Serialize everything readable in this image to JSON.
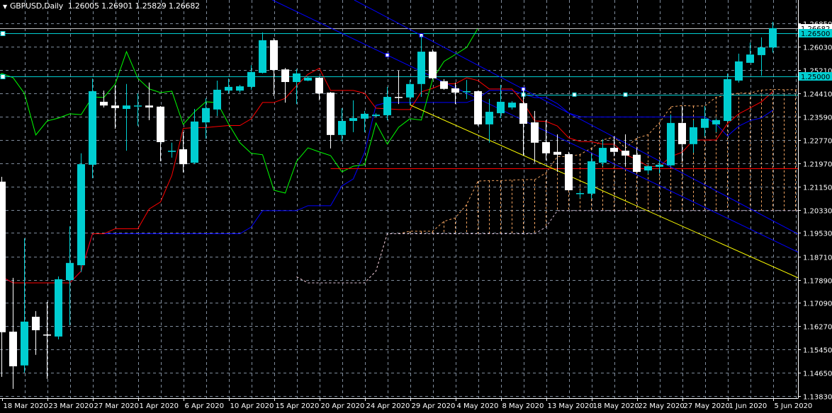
{
  "header": {
    "collapse_icon": "triangle-down-icon",
    "symbol_timeframe": "GBPUSD,Daily",
    "open": "1.26005",
    "high": "1.26901",
    "low": "1.25829",
    "close": "1.26682"
  },
  "colors": {
    "background": "#000000",
    "grid": "#7f8c9c",
    "bull": "#00CED1",
    "bear": "#FFFFFF",
    "tenkan": "#FF0000",
    "kijun": "#0000FF",
    "chikou": "#00FF00",
    "senkou_a": "#F4A460",
    "senkou_b": "#D8BFD8",
    "trend_blue": "#0000FF",
    "trend_yellow": "#FFFF00",
    "level_cyan": "#00CED1",
    "level_red": "#FF0000",
    "bid": "#C0C0C0"
  },
  "chart_data": {
    "type": "candlestick",
    "title": "GBPUSD,Daily",
    "ylim": [
      1.13757,
      1.27665
    ],
    "grid": true,
    "price_ticks": [
      "1.26850",
      "1.26030",
      "1.25210",
      "1.24410",
      "1.23590",
      "1.22770",
      "1.21970",
      "1.21150",
      "1.20330",
      "1.19530",
      "1.18710",
      "1.17890",
      "1.17090",
      "1.16270",
      "1.15450",
      "1.14650",
      "1.13830"
    ],
    "date_labels": [
      {
        "bar": 0,
        "text": "18 Mar 2020"
      },
      {
        "bar": 4,
        "text": "23 Mar 2020"
      },
      {
        "bar": 8,
        "text": "27 Mar 2020"
      },
      {
        "bar": 12,
        "text": "1 Apr 2020"
      },
      {
        "bar": 16,
        "text": "6 Apr 2020"
      },
      {
        "bar": 20,
        "text": "10 Apr 2020"
      },
      {
        "bar": 24,
        "text": "15 Apr 2020"
      },
      {
        "bar": 28,
        "text": "20 Apr 2020"
      },
      {
        "bar": 32,
        "text": "24 Apr 2020"
      },
      {
        "bar": 36,
        "text": "29 Apr 2020"
      },
      {
        "bar": 40,
        "text": "4 May 2020"
      },
      {
        "bar": 44,
        "text": "8 May 2020"
      },
      {
        "bar": 48,
        "text": "13 May 2020"
      },
      {
        "bar": 52,
        "text": "18 May 2020"
      },
      {
        "bar": 56,
        "text": "22 May 2020"
      },
      {
        "bar": 60,
        "text": "27 May 2020"
      },
      {
        "bar": 64,
        "text": "1 Jun 2020"
      },
      {
        "bar": 68,
        "text": "5 Jun 2020"
      }
    ],
    "candles_ohlc": [
      [
        1.2132,
        1.2149,
        1.145,
        1.1606
      ],
      [
        1.1608,
        1.1796,
        1.1408,
        1.1487
      ],
      [
        1.149,
        1.1934,
        1.1465,
        1.1643
      ],
      [
        1.166,
        1.168,
        1.1527,
        1.1613
      ],
      [
        1.1598,
        1.1712,
        1.1443,
        1.1596
      ],
      [
        1.1591,
        1.1801,
        1.1581,
        1.1791
      ],
      [
        1.1788,
        1.1976,
        1.163,
        1.1848
      ],
      [
        1.184,
        1.2231,
        1.1816,
        1.2193
      ],
      [
        1.2191,
        1.2492,
        1.2144,
        1.2448
      ],
      [
        1.2411,
        1.245,
        1.2391,
        1.2398
      ],
      [
        1.2398,
        1.2468,
        1.2317,
        1.2389
      ],
      [
        1.2386,
        1.2473,
        1.224,
        1.2398
      ],
      [
        1.2397,
        1.244,
        1.2327,
        1.2398
      ],
      [
        1.2398,
        1.2478,
        1.2347,
        1.2391
      ],
      [
        1.2394,
        1.2396,
        1.2203,
        1.227
      ],
      [
        1.2236,
        1.2268,
        1.2216,
        1.224
      ],
      [
        1.2245,
        1.2305,
        1.2164,
        1.2193
      ],
      [
        1.2198,
        1.2386,
        1.2193,
        1.2342
      ],
      [
        1.2339,
        1.2423,
        1.2282,
        1.2389
      ],
      [
        1.2384,
        1.2485,
        1.2361,
        1.2453
      ],
      [
        1.245,
        1.2492,
        1.244,
        1.2463
      ],
      [
        1.245,
        1.247,
        1.2443,
        1.2465
      ],
      [
        1.2463,
        1.2539,
        1.2453,
        1.2515
      ],
      [
        1.2512,
        1.2653,
        1.251,
        1.2626
      ],
      [
        1.2626,
        1.2633,
        1.2431,
        1.2522
      ],
      [
        1.2524,
        1.2529,
        1.2408,
        1.248
      ],
      [
        1.248,
        1.2525,
        1.2403,
        1.251
      ],
      [
        1.2485,
        1.25,
        1.2483,
        1.2495
      ],
      [
        1.2495,
        1.2497,
        1.2416,
        1.244
      ],
      [
        1.2443,
        1.2445,
        1.2248,
        1.2295
      ],
      [
        1.2295,
        1.2389,
        1.2273,
        1.2344
      ],
      [
        1.2344,
        1.2416,
        1.2305,
        1.2354
      ],
      [
        1.2352,
        1.2379,
        1.2305,
        1.2369
      ],
      [
        1.2361,
        1.2371,
        1.2359,
        1.2366
      ],
      [
        1.2364,
        1.2463,
        1.2347,
        1.2428
      ],
      [
        1.2428,
        1.252,
        1.2403,
        1.2426
      ],
      [
        1.2426,
        1.2487,
        1.2401,
        1.2473
      ],
      [
        1.2473,
        1.2643,
        1.2428,
        1.2586
      ],
      [
        1.2586,
        1.2594,
        1.249,
        1.2493
      ],
      [
        1.2483,
        1.249,
        1.2453,
        1.2456
      ],
      [
        1.2458,
        1.2478,
        1.2403,
        1.2443
      ],
      [
        1.2447,
        1.2487,
        1.2421,
        1.2448
      ],
      [
        1.2448,
        1.245,
        1.2327,
        1.2332
      ],
      [
        1.2332,
        1.2421,
        1.2268,
        1.2376
      ],
      [
        1.2371,
        1.247,
        1.2354,
        1.2411
      ],
      [
        1.2391,
        1.2413,
        1.2384,
        1.2408
      ],
      [
        1.2406,
        1.2453,
        1.2223,
        1.2334
      ],
      [
        1.2339,
        1.2379,
        1.2198,
        1.2268
      ],
      [
        1.227,
        1.2347,
        1.2206,
        1.2231
      ],
      [
        1.2236,
        1.2297,
        1.2166,
        1.2226
      ],
      [
        1.2228,
        1.2236,
        1.21,
        1.2102
      ],
      [
        1.209,
        1.21,
        1.2075,
        1.2092
      ],
      [
        1.209,
        1.2228,
        1.2073,
        1.2203
      ],
      [
        1.2198,
        1.228,
        1.2186,
        1.225
      ],
      [
        1.225,
        1.229,
        1.2221,
        1.2236
      ],
      [
        1.224,
        1.2297,
        1.2186,
        1.2223
      ],
      [
        1.2226,
        1.2248,
        1.2164,
        1.2166
      ],
      [
        1.2171,
        1.2189,
        1.2159,
        1.2186
      ],
      [
        1.2184,
        1.2206,
        1.2161,
        1.2191
      ],
      [
        1.2189,
        1.2366,
        1.2186,
        1.2337
      ],
      [
        1.2337,
        1.2396,
        1.2203,
        1.2263
      ],
      [
        1.2263,
        1.2347,
        1.2233,
        1.2322
      ],
      [
        1.232,
        1.2396,
        1.229,
        1.2352
      ],
      [
        1.2332,
        1.2352,
        1.2305,
        1.2347
      ],
      [
        1.2344,
        1.251,
        1.2342,
        1.249
      ],
      [
        1.2485,
        1.2579,
        1.2478,
        1.2552
      ],
      [
        1.2547,
        1.2618,
        1.2574,
        1.2576
      ],
      [
        1.2574,
        1.2636,
        1.2502,
        1.2601
      ],
      [
        1.26005,
        1.26901,
        1.25829,
        1.26682
      ]
    ],
    "ichimoku": {
      "tenkan": 9,
      "kijun": 26,
      "senkou_b": 52
    },
    "levels": [
      {
        "name": "level-1-265",
        "price": 1.265,
        "label": "1.26500",
        "color": "level_cyan",
        "from_bar": 0,
        "boxed": true
      },
      {
        "name": "level-1-250",
        "price": 1.25,
        "label": "1.25000",
        "color": "level_cyan",
        "from_bar": 0,
        "boxed": true
      },
      {
        "name": "level-1-2436",
        "price": 1.2436,
        "label": "",
        "color": "level_cyan",
        "from_bar": 46,
        "boxed": false
      },
      {
        "name": "level-1-2179",
        "price": 1.2179,
        "label": "",
        "color": "level_red",
        "from_bar": 29,
        "boxed": false
      }
    ],
    "bid": {
      "price": 1.26682,
      "label": "1.26682"
    },
    "trendlines": [
      {
        "name": "channel-upper-line",
        "color": "trend_blue",
        "p1": [
          37,
          1.2643
        ],
        "p2": [
          46,
          1.2455
        ],
        "anchors": true
      },
      {
        "name": "channel-lower-line",
        "color": "trend_blue",
        "p1": [
          34,
          1.2574
        ],
        "p2": [
          37,
          1.2517
        ],
        "anchors": true
      },
      {
        "name": "yellow-trendline",
        "color": "trend_yellow",
        "p1": [
          36,
          1.24
        ],
        "p2": [
          70,
          1.18
        ],
        "anchors": false
      }
    ],
    "level_anchors": [
      [
        46,
        1.2436
      ],
      [
        50.5,
        1.2436
      ],
      [
        55,
        1.2436
      ]
    ]
  }
}
